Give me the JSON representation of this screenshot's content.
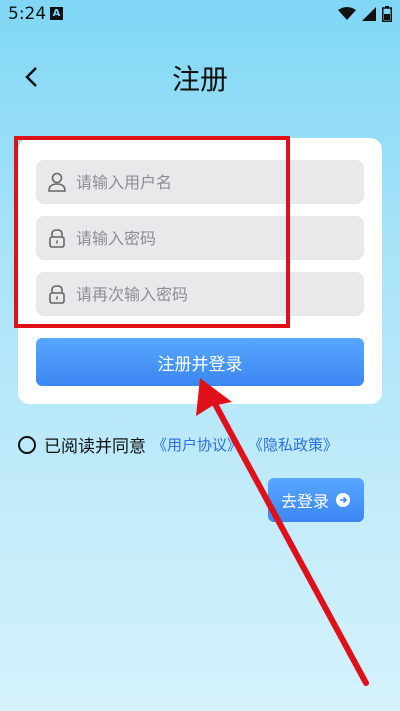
{
  "status": {
    "time": "5:24",
    "app_badge": "A"
  },
  "header": {
    "title": "注册"
  },
  "form": {
    "username_placeholder": "请输入用户名",
    "password_placeholder": "请输入密码",
    "confirm_placeholder": "请再次输入密码",
    "register_label": "注册并登录"
  },
  "agreement": {
    "text": "已阅读并同意",
    "user_agreement": "《用户协议》",
    "privacy_policy": "《隐私政策》"
  },
  "login": {
    "label": "去登录"
  },
  "colors": {
    "accent": "#3c86f2",
    "highlight": "#e0101b",
    "link": "#2c70d8"
  }
}
